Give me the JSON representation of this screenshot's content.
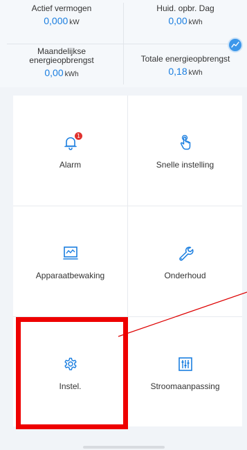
{
  "stats": {
    "active_power": {
      "label": "Actief vermogen",
      "value": "0,000",
      "unit": "kW"
    },
    "daily_yield": {
      "label": "Huid. opbr. Dag",
      "value": "0,00",
      "unit": "kWh"
    },
    "monthly_yield": {
      "label": "Maandelijkse energieopbrengst",
      "value": "0,00",
      "unit": "kWh"
    },
    "total_yield": {
      "label": "Totale energieopbrengst",
      "value": "0,18",
      "unit": "kWh"
    }
  },
  "menu": {
    "alarm": {
      "label": "Alarm",
      "badge": "1",
      "icon": "bell-icon"
    },
    "quick_setting": {
      "label": "Snelle instelling",
      "icon": "hand-tap-icon"
    },
    "device_monitoring": {
      "label": "Apparaatbewaking",
      "icon": "monitor-icon"
    },
    "maintenance": {
      "label": "Onderhoud",
      "icon": "wrench-icon"
    },
    "settings": {
      "label": "Instel.",
      "icon": "gear-icon"
    },
    "power_adjustment": {
      "label": "Stroomaanpassing",
      "icon": "sliders-icon"
    }
  },
  "colors": {
    "accent": "#1a7ee0",
    "badge": "#e0322e",
    "highlight": "#ee0000"
  }
}
